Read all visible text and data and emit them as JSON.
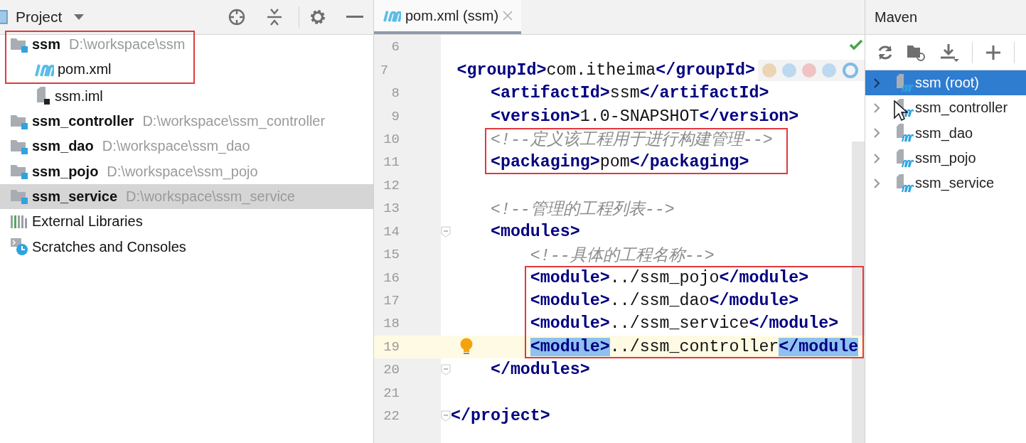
{
  "project_panel": {
    "title": "Project",
    "items": [
      {
        "kind": "module",
        "name": "ssm",
        "path": "D:\\workspace\\ssm",
        "selected": false,
        "boxed": true,
        "children": [
          {
            "kind": "maven_file",
            "name": "pom.xml",
            "selected": false,
            "boxed": true
          },
          {
            "kind": "iml_file",
            "name": "ssm.iml",
            "selected": false,
            "boxed": false
          }
        ]
      },
      {
        "kind": "module",
        "name": "ssm_controller",
        "path": "D:\\workspace\\ssm_controller",
        "selected": false,
        "boxed": false
      },
      {
        "kind": "module",
        "name": "ssm_dao",
        "path": "D:\\workspace\\ssm_dao",
        "selected": false,
        "boxed": false
      },
      {
        "kind": "module",
        "name": "ssm_pojo",
        "path": "D:\\workspace\\ssm_pojo",
        "selected": false,
        "boxed": false
      },
      {
        "kind": "module",
        "name": "ssm_service",
        "path": "D:\\workspace\\ssm_service",
        "selected": true,
        "boxed": false
      },
      {
        "kind": "libraries",
        "name": "External Libraries",
        "selected": false,
        "boxed": false
      },
      {
        "kind": "scratches",
        "name": "Scratches and Consoles",
        "selected": false,
        "boxed": false
      }
    ]
  },
  "editor": {
    "tabs": [
      {
        "label": "pom.xml (ssm)",
        "selected": true
      }
    ],
    "lines": [
      {
        "number": "6",
        "boxed": false,
        "current": false,
        "fold": false,
        "bulb": false
      },
      {
        "number": "7",
        "code": "    <groupId>com.itheima</groupId>",
        "boxed": false,
        "current": false,
        "highlighted": false,
        "fold": false,
        "bulb": false
      },
      {
        "number": "8",
        "code": "    <artifactId>ssm</artifactId>",
        "boxed": false,
        "current": false,
        "highlighted": false,
        "fold": false,
        "bulb": false
      },
      {
        "number": "9",
        "code": "    <version>1.0-SNAPSHOT</version>",
        "boxed": false,
        "current": false,
        "highlighted": false,
        "fold": false,
        "bulb": false
      },
      {
        "number": "10",
        "code": "    <!--定义该工程用于进行构建管理-->",
        "boxed": true,
        "current": false,
        "highlighted": false,
        "fold": false,
        "bulb": false
      },
      {
        "number": "11",
        "code": "    <packaging>pom</packaging>",
        "boxed": true,
        "current": false,
        "highlighted": false,
        "fold": false,
        "bulb": false
      },
      {
        "number": "12",
        "boxed": false,
        "current": false,
        "fold": false,
        "bulb": false
      },
      {
        "number": "13",
        "code": "    <!--管理的工程列表-->",
        "boxed": false,
        "current": false,
        "highlighted": false,
        "fold": false,
        "bulb": false
      },
      {
        "number": "14",
        "code": "    <modules>",
        "boxed": false,
        "current": false,
        "highlighted": false,
        "fold": true,
        "bulb": false
      },
      {
        "number": "15",
        "code": "        <!--具体的工程名称-->",
        "boxed": false,
        "current": false,
        "highlighted": false,
        "fold": false,
        "bulb": false
      },
      {
        "number": "16",
        "code": "        <module>../ssm_pojo</module>",
        "boxed": true,
        "current": false,
        "highlighted": false,
        "fold": false,
        "bulb": false
      },
      {
        "number": "17",
        "code": "        <module>../ssm_dao</module>",
        "boxed": true,
        "current": false,
        "highlighted": false,
        "fold": false,
        "bulb": false
      },
      {
        "number": "18",
        "code": "        <module>../ssm_service</module>",
        "boxed": true,
        "current": false,
        "highlighted": false,
        "fold": false,
        "bulb": false
      },
      {
        "number": "19",
        "code": "        <module>../ssm_controller</module",
        "boxed": true,
        "current": true,
        "highlighted": true,
        "fold": false,
        "bulb": true
      },
      {
        "number": "20",
        "code": "    </modules>",
        "boxed": false,
        "current": false,
        "highlighted": false,
        "fold": true,
        "bulb": false
      },
      {
        "number": "21",
        "boxed": false,
        "current": false,
        "fold": false,
        "bulb": false
      },
      {
        "number": "22",
        "code": "</project>",
        "boxed": false,
        "current": false,
        "highlighted": false,
        "fold": true,
        "bulb": false
      }
    ]
  },
  "maven_panel": {
    "title": "Maven",
    "items": [
      {
        "name": "ssm (root)",
        "selected": true,
        "expanded": false
      },
      {
        "name": "ssm_controller",
        "selected": false,
        "expanded": false
      },
      {
        "name": "ssm_dao",
        "selected": false,
        "expanded": false
      },
      {
        "name": "ssm_pojo",
        "selected": false,
        "expanded": false
      },
      {
        "name": "ssm_service",
        "selected": false,
        "expanded": false
      }
    ]
  }
}
